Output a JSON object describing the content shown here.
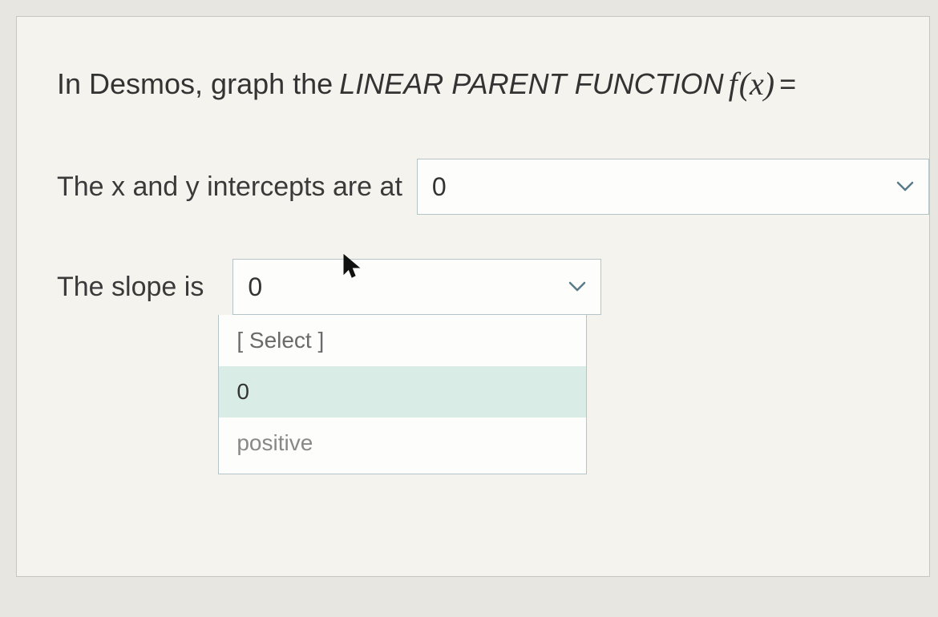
{
  "prompt": {
    "prefix": "In Desmos, graph the ",
    "emphasis": "LINEAR PARENT FUNCTION",
    "func_f": "f",
    "func_x": "(x)",
    "suffix": " ="
  },
  "intercepts": {
    "label": "The x and y intercepts are at",
    "value": "0"
  },
  "slope": {
    "label": "The slope is",
    "value": "0",
    "options": {
      "placeholder": "[ Select ]",
      "opt0": "0",
      "opt1": "positive"
    }
  }
}
